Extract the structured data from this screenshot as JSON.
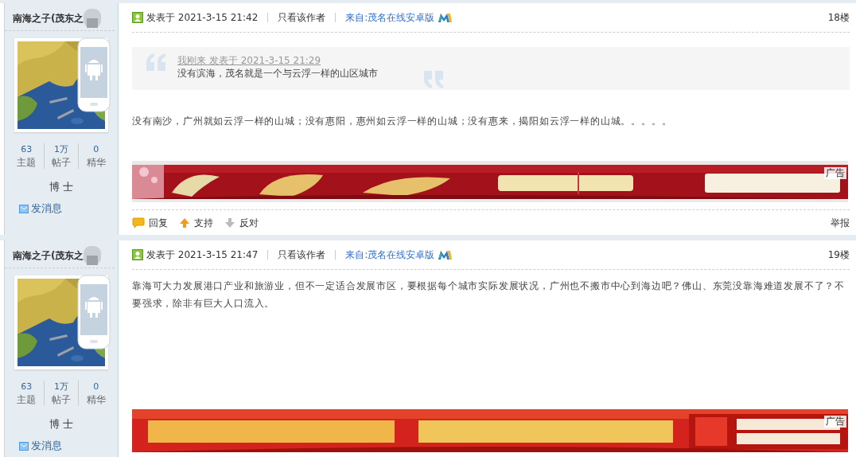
{
  "posts": [
    {
      "author": {
        "name": "南海之子(茂东之",
        "stats": [
          {
            "value": "63",
            "label": "主题"
          },
          {
            "value": "1万",
            "label": "帖子"
          },
          {
            "value": "0",
            "label": "精华"
          }
        ],
        "rank": "博 士",
        "message_link": "发消息"
      },
      "posted": "发表于 2021-3-15 21:42",
      "author_only": "只看该作者",
      "source": "来自:茂名在线安卓版",
      "floor": "18楼",
      "quote": {
        "byline": "我刚来 发表于 2021-3-15 21:29",
        "text": "没有滨海，茂名就是一个与云浮一样的山区城市"
      },
      "body": "没有南沙，广州就如云浮一样的山城；没有惠阳，惠州如云浮一样的山城；没有惠来，揭阳如云浮一样的山城。。。。。",
      "ad": {
        "kind": "picture",
        "label": "广告"
      },
      "actions": [
        {
          "kind": "reply",
          "label": "回复"
        },
        {
          "kind": "up",
          "label": "支持"
        },
        {
          "kind": "down",
          "label": "反对"
        }
      ],
      "report": "举报"
    },
    {
      "author": {
        "name": "南海之子(茂东之",
        "stats": [
          {
            "value": "63",
            "label": "主题"
          },
          {
            "value": "1万",
            "label": "帖子"
          },
          {
            "value": "0",
            "label": "精华"
          }
        ],
        "rank": "博 士",
        "message_link": "发消息"
      },
      "posted": "发表于 2021-3-15 21:47",
      "author_only": "只看该作者",
      "source": "来自:茂名在线安卓版",
      "floor": "19楼",
      "body": "靠海可大力发展港口产业和旅游业，但不一定适合发展市区，要根据每个城市实际发展状况，广州也不搬市中心到海边吧？佛山、东莞没靠海难道发展不了？不要强求，除非有巨大人口流入。",
      "ad": {
        "kind": "picture",
        "label": "广告"
      }
    }
  ]
}
